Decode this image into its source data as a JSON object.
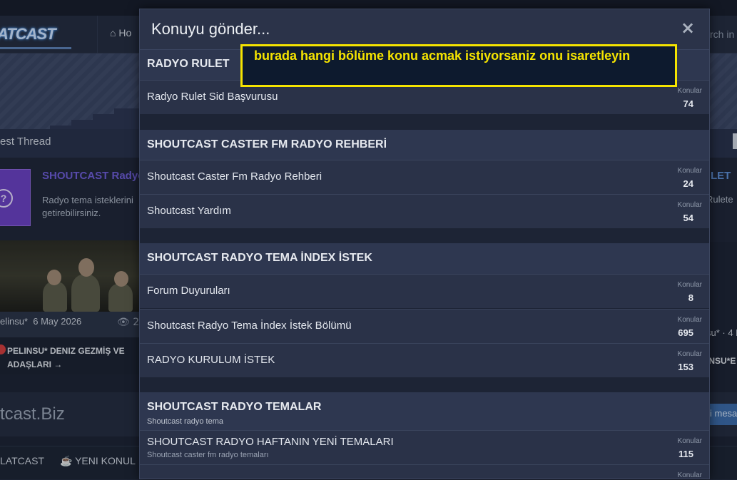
{
  "background": {
    "logo": "ATCAST",
    "nav_home": "Ho",
    "search_text": "rch in",
    "thread_label": "est Thread",
    "card": {
      "title": "SHOUTCAST Radyo",
      "description": "Radyo tema isteklerini getirebilirsiniz.",
      "right_title": "LET",
      "right_desc": "Rulete"
    },
    "meta": {
      "author": "elinsu*",
      "date": "6 May 2026",
      "views": "2",
      "right": "su* · 4 M"
    },
    "post": {
      "title": "PELINSU* DENIZ GEZMİŞ VE ADAŞLARI →",
      "right": "INSU*E"
    },
    "site": {
      "name": "tcast.Biz",
      "button": "i mesa"
    },
    "bottom_nav": {
      "item1": "LATCAST",
      "item2": "☕  YENI KONUL"
    }
  },
  "modal": {
    "title": "Konuyu gönder...",
    "close_icon": "×",
    "annotation": "burada hangi bölüme konu acmak istiyorsaniz onu isaretleyin",
    "stat_label": "Konular",
    "sections": [
      {
        "title": "RADYO RULET",
        "nodes": [
          {
            "title": "Radyo Rulet Sid Başvurusu",
            "count": "74"
          }
        ]
      },
      {
        "title": "SHOUTCAST CASTER FM RADYO REHBERİ",
        "nodes": [
          {
            "title": "Shoutcast Caster Fm Radyo Rehberi",
            "count": "24"
          },
          {
            "title": "Shoutcast Yardım",
            "count": "54"
          }
        ]
      },
      {
        "title": "SHOUTCAST RADYO TEMA İNDEX İSTEK",
        "nodes": [
          {
            "title": "Forum Duyuruları",
            "count": "8"
          },
          {
            "title": "Shoutcast Radyo Tema İndex İstek Bölümü",
            "count": "695"
          },
          {
            "title": "RADYO KURULUM İSTEK",
            "count": "153"
          }
        ]
      },
      {
        "title": "SHOUTCAST RADYO TEMALAR",
        "subtitle": "Shoutcast radyo tema",
        "nodes": [
          {
            "title": "SHOUTCAST RADYO HAFTANIN YENİ TEMALARI",
            "description": "Shoutcast caster fm radyo temaları",
            "count": "115"
          }
        ]
      }
    ]
  },
  "colors": {
    "modal_bg": "#1d2435",
    "section_head": "#2e3750",
    "node_bg": "#2a3248",
    "annotation": "#f5e400"
  }
}
